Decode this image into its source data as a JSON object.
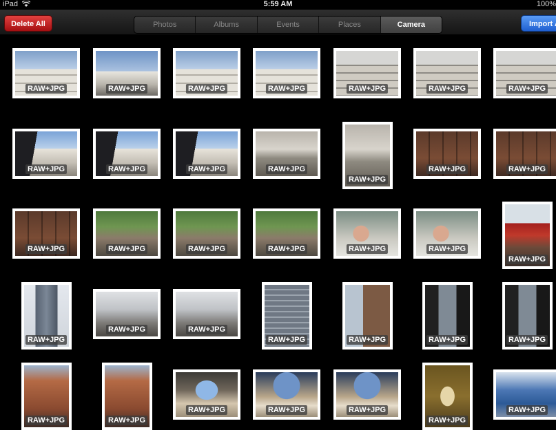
{
  "status_bar": {
    "carrier": "iPad",
    "time": "5:59 AM",
    "battery": "100%"
  },
  "toolbar": {
    "delete_all": "Delete All",
    "import_all": "Import All",
    "tabs": [
      {
        "label": "Photos",
        "active": false
      },
      {
        "label": "Albums",
        "active": false
      },
      {
        "label": "Events",
        "active": false
      },
      {
        "label": "Places",
        "active": false
      },
      {
        "label": "Camera",
        "active": true
      }
    ]
  },
  "photo_grid": {
    "badge_label": "RAW+JPG",
    "rows": [
      [
        "guggen",
        "sky",
        "guggen",
        "guggen",
        "guggen-grey",
        "guggen-grey",
        "guggen-grey"
      ],
      [
        "hand",
        "hand",
        "hand",
        "plaza",
        "plaza",
        "brick",
        "brick"
      ],
      [
        "brick",
        "street",
        "street",
        "street",
        "face",
        "face",
        "storefront"
      ],
      [
        "tower",
        "arch",
        "arch",
        "bldg",
        "bldg2",
        "dark",
        "dark"
      ],
      [
        "terracotta",
        "terracotta",
        "hall",
        "hall2",
        "hall2",
        "hall3",
        "hall4"
      ]
    ]
  }
}
